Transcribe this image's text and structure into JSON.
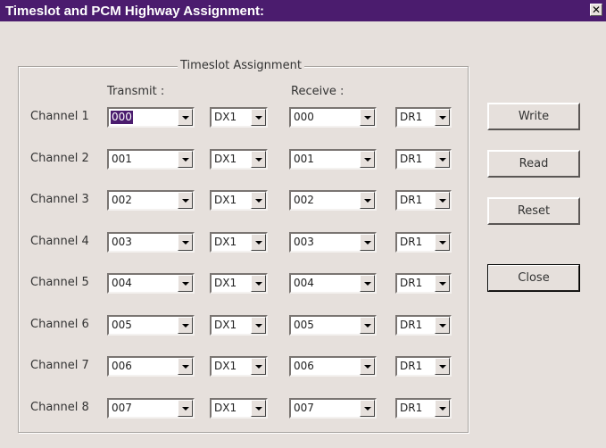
{
  "window": {
    "title": "Timeslot and PCM Highway Assignment:",
    "close_glyph": "✕"
  },
  "group": {
    "label": "Timeslot Assignment",
    "transmit_header": "Transmit :",
    "receive_header": "Receive :"
  },
  "channels": [
    {
      "label": "Channel 1",
      "tx_slot": "000",
      "tx_hw": "DX1",
      "rx_slot": "000",
      "rx_hw": "DR1"
    },
    {
      "label": "Channel 2",
      "tx_slot": "001",
      "tx_hw": "DX1",
      "rx_slot": "001",
      "rx_hw": "DR1"
    },
    {
      "label": "Channel 3",
      "tx_slot": "002",
      "tx_hw": "DX1",
      "rx_slot": "002",
      "rx_hw": "DR1"
    },
    {
      "label": "Channel 4",
      "tx_slot": "003",
      "tx_hw": "DX1",
      "rx_slot": "003",
      "rx_hw": "DR1"
    },
    {
      "label": "Channel 5",
      "tx_slot": "004",
      "tx_hw": "DX1",
      "rx_slot": "004",
      "rx_hw": "DR1"
    },
    {
      "label": "Channel 6",
      "tx_slot": "005",
      "tx_hw": "DX1",
      "rx_slot": "005",
      "rx_hw": "DR1"
    },
    {
      "label": "Channel 7",
      "tx_slot": "006",
      "tx_hw": "DX1",
      "rx_slot": "006",
      "rx_hw": "DR1"
    },
    {
      "label": "Channel 8",
      "tx_slot": "007",
      "tx_hw": "DX1",
      "rx_slot": "007",
      "rx_hw": "DR1"
    }
  ],
  "buttons": {
    "write": "Write",
    "read": "Read",
    "reset": "Reset",
    "close": "Close"
  },
  "colors": {
    "titlebar": "#4b1c6e",
    "dialog_bg": "#e6e0dc"
  }
}
